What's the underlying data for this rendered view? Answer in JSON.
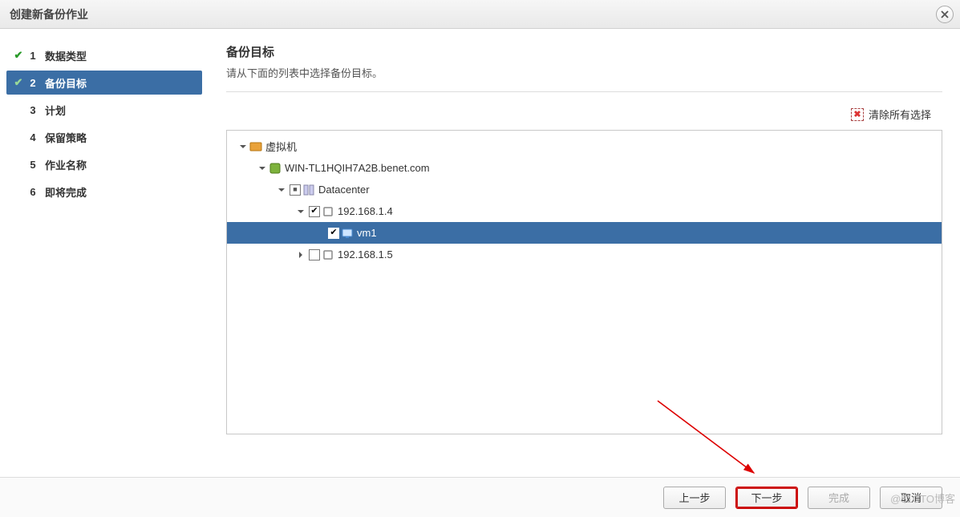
{
  "window": {
    "title": "创建新备份作业"
  },
  "steps": [
    {
      "num": "1",
      "label": "数据类型",
      "checked": true,
      "active": false
    },
    {
      "num": "2",
      "label": "备份目标",
      "checked": true,
      "active": true
    },
    {
      "num": "3",
      "label": "计划",
      "checked": false,
      "active": false
    },
    {
      "num": "4",
      "label": "保留策略",
      "checked": false,
      "active": false
    },
    {
      "num": "5",
      "label": "作业名称",
      "checked": false,
      "active": false
    },
    {
      "num": "6",
      "label": "即将完成",
      "checked": false,
      "active": false
    }
  ],
  "panel": {
    "heading": "备份目标",
    "description": "请从下面的列表中选择备份目标。",
    "clear_label": "清除所有选择"
  },
  "tree": {
    "root": {
      "label": "虚拟机",
      "expanded": true,
      "check": "none"
    },
    "server": {
      "label": "WIN-TL1HQIH7A2B.benet.com",
      "expanded": true,
      "check": "none"
    },
    "datacenter": {
      "label": "Datacenter",
      "expanded": true,
      "check": "partial"
    },
    "host1": {
      "label": "192.168.1.4",
      "expanded": true,
      "check": "checked"
    },
    "vm1": {
      "label": "vm1",
      "selected": true,
      "check": "checked"
    },
    "host2": {
      "label": "192.168.1.5",
      "expanded": false,
      "check": "none"
    }
  },
  "footer": {
    "prev": "上一步",
    "next": "下一步",
    "finish": "完成",
    "cancel": "取消"
  },
  "watermark": "@51CTO博客"
}
